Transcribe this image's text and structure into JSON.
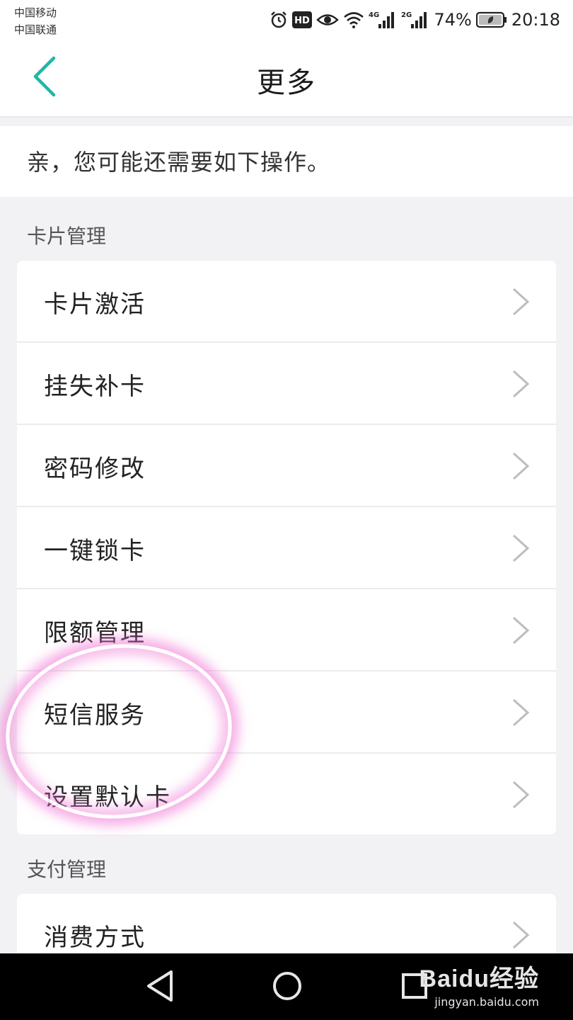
{
  "status_bar": {
    "carrier_1": "中国移动",
    "carrier_2": "中国联通",
    "hd": "HD",
    "net_1": "4G",
    "net_2": "2G",
    "battery": "74%",
    "time": "20:18",
    "icons": [
      "alarm-icon",
      "hd-icon",
      "eye-icon",
      "wifi-icon",
      "signal-4g-icon",
      "signal-2g-icon",
      "battery-icon"
    ]
  },
  "nav": {
    "title": "更多",
    "back_icon": "chevron-left-icon",
    "accent": "#1fb7a6"
  },
  "intro": {
    "text": "亲，您可能还需要如下操作。"
  },
  "sections": [
    {
      "title": "卡片管理",
      "items": [
        {
          "label": "卡片激活"
        },
        {
          "label": "挂失补卡"
        },
        {
          "label": "密码修改"
        },
        {
          "label": "一键锁卡"
        },
        {
          "label": "限额管理"
        },
        {
          "label": "短信服务"
        },
        {
          "label": "设置默认卡"
        }
      ]
    },
    {
      "title": "支付管理",
      "items": [
        {
          "label": "消费方式"
        }
      ]
    }
  ],
  "annotation": {
    "highlight_color": "#f06ed2",
    "highlight_target": "短信服务"
  },
  "system_nav": {
    "back": "triangle-back-icon",
    "home": "circle-home-icon",
    "recents": "square-recents-icon"
  },
  "watermark": {
    "brand": "Baidu经验",
    "url": "jingyan.baidu.com"
  }
}
